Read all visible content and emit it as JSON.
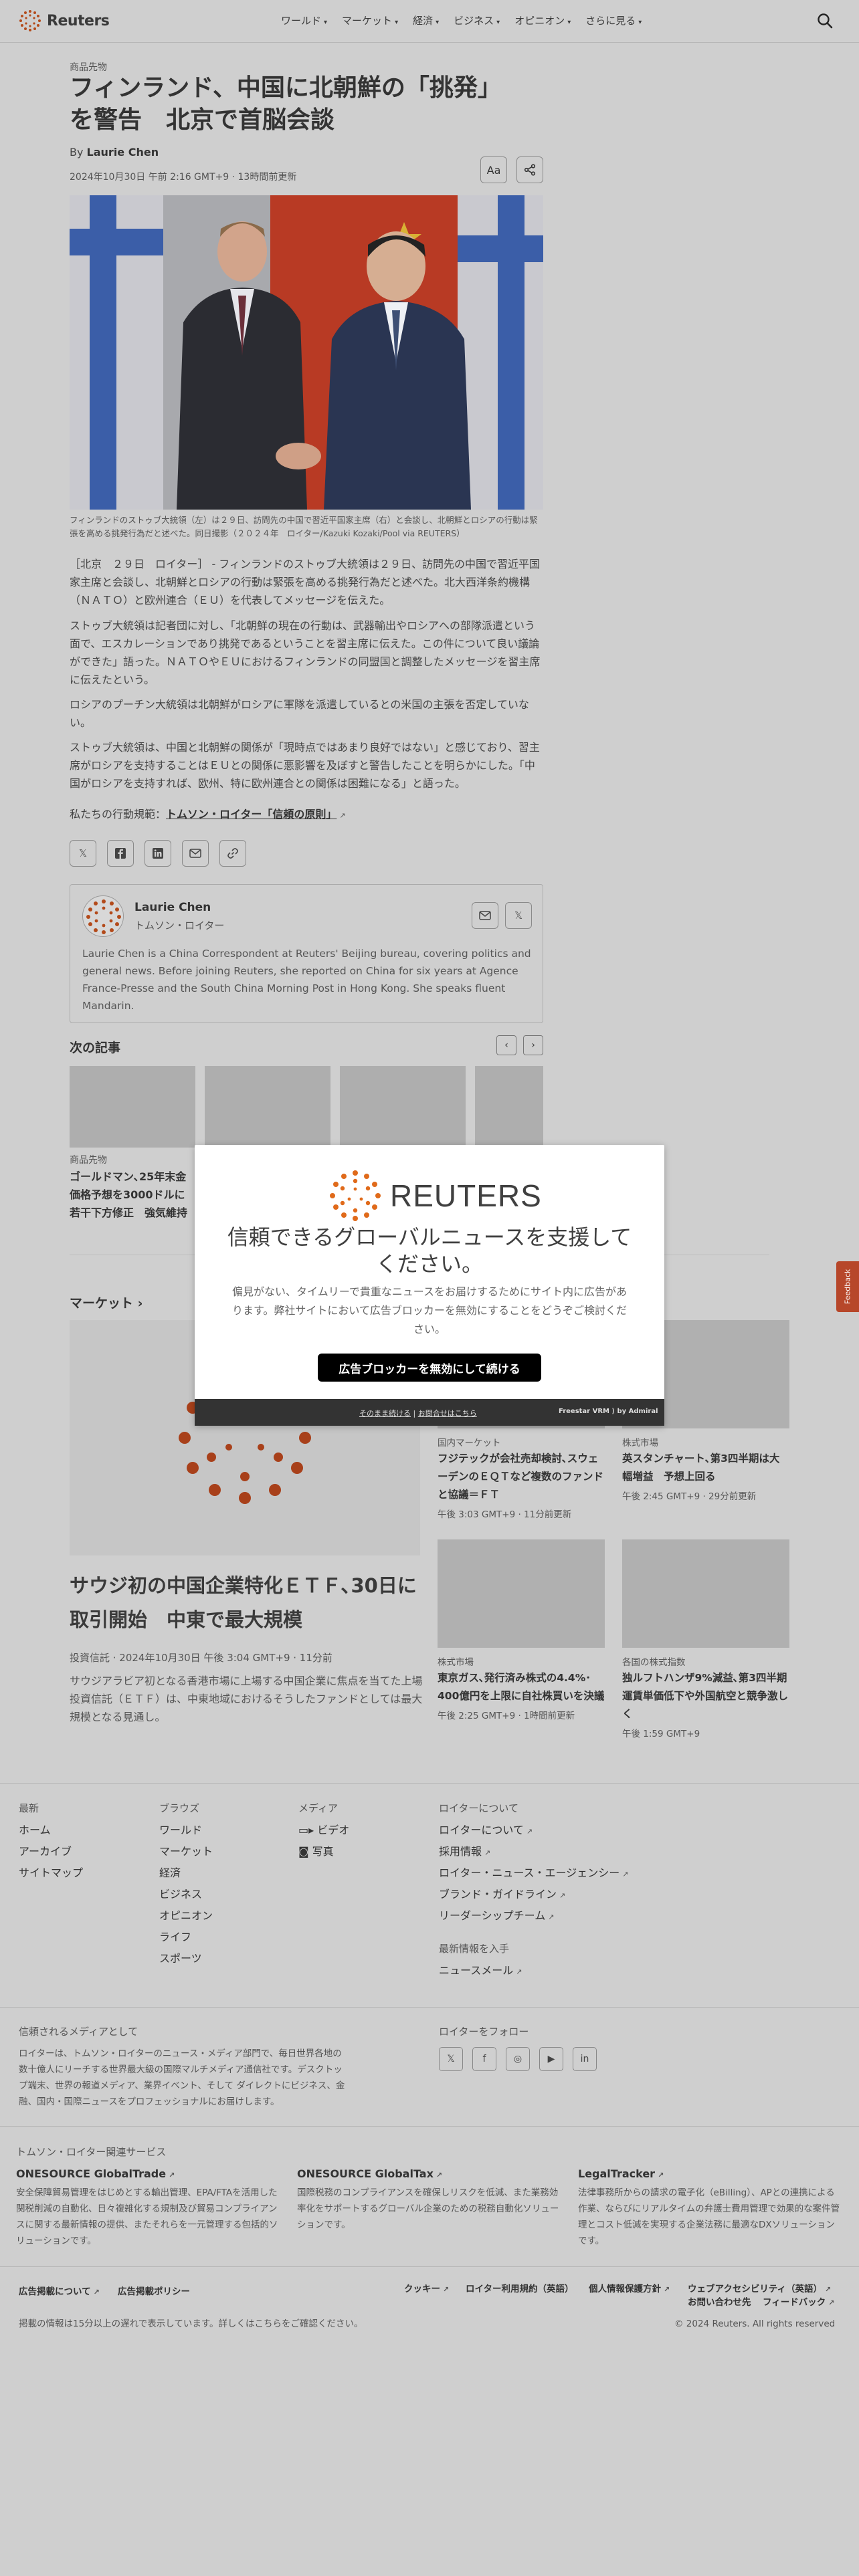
{
  "header": {
    "brand": "Reuters",
    "nav": [
      "ワールド",
      "マーケット",
      "経済",
      "ビジネス",
      "オピニオン",
      "さらに見る"
    ]
  },
  "article": {
    "kicker": "商品先物",
    "headline_line1": "フィンランド、中国に北朝鮮の「挑発」",
    "headline_line2": "を警告　北京で首脳会談",
    "byline_prefix": "By",
    "author": "Laurie Chen",
    "dateline": "2024年10月30日 午前 2:16 GMT+9 · 13時間前更新",
    "font_button": "Aa",
    "caption": "フィンランドのストゥブ大統領（左）は２９日、訪問先の中国で習近平国家主席（右）と会談し、北朝鮮とロシアの行動は緊張を高める挑発行為だと述べた。同日撮影（２０２４年　ロイター/Kazuki Kozaki/Pool via REUTERS）",
    "paragraphs": [
      "［北京　２９日　ロイター］ - フィンランドのストゥブ大統領は２９日、訪問先の中国で習近平国家主席と会談し、北朝鮮とロシアの行動は緊張を高める挑発行為だと述べた。北大西洋条約機構（ＮＡＴＯ）と欧州連合（ＥＵ）を代表してメッセージを伝えた。",
      "ストゥブ大統領は記者団に対し、「北朝鮮の現在の行動は、武器輸出やロシアへの部隊派遣という面で、エスカレーションであり挑発であるということを習主席に伝えた。この件について良い議論ができた」語った。ＮＡＴＯやＥＵにおけるフィンランドの同盟国と調整したメッセージを習主席に伝えたという。",
      "ロシアのプーチン大統領は北朝鮮がロシアに軍隊を派遣しているとの米国の主張を否定していない。",
      "ストゥブ大統領は、中国と北朝鮮の関係が「現時点ではあまり良好ではない」と感じており、習主席がロシアを支持することはＥＵとの関係に悪影響を及ぼすと警告したことを明らかにした。「中国がロシアを支持すれば、欧州、特に欧州連合との関係は困難になる」と語った。"
    ],
    "standards_prefix": "私たちの行動規範：",
    "standards_link": "トムソン・ロイター「信頼の原則」"
  },
  "author_box": {
    "name": "Laurie Chen",
    "org": "トムソン・ロイター",
    "bio": "Laurie Chen is a China Correspondent at Reuters' Beijing bureau, covering politics and general news. Before joining Reuters, she reported on China for six years at Agence France-Presse and the South China Morning Post in Hong Kong. She speaks fluent Mandarin."
  },
  "next": {
    "title": "次の記事",
    "cards": [
      {
        "category": "商品先物",
        "title": "ゴールドマン､25年末金価格予想を3000ドルに若干下方修正　強気維持"
      }
    ]
  },
  "markets": {
    "title": "マーケット",
    "main": {
      "title": "サウジ初の中国企業特化ＥＴＦ､30日に取引開始　中東で最大規模",
      "meta": "投資信託 · 2024年10月30日 午後 3:04 GMT+9 · 11分前",
      "desc": "サウジアラビア初となる香港市場に上場する中国企業に焦点を当てた上場投資信託（ＥＴＦ）は、中東地域におけるそうしたファンドとしては最大規模となる見通し。"
    },
    "cards": [
      {
        "category": "国内マーケット",
        "title": "フジテックが会社売却検討､スウェーデンのＥＱＴなど複数のファンドと協議＝ＦＴ",
        "time": "午後 3:03 GMT+9 · 11分前更新"
      },
      {
        "category": "株式市場",
        "title": "英スタンチャート､第3四半期は大幅増益　予想上回る",
        "time": "午後 2:45 GMT+9 · 29分前更新"
      },
      {
        "category": "株式市場",
        "title": "東京ガス､発行済み株式の4.4%･400億円を上限に自社株買いを決議",
        "time": "午後 2:25 GMT+9 · 1時間前更新"
      },
      {
        "category": "各国の株式指数",
        "title": "独ルフトハンザ9%減益､第3四半期　運賃単価低下や外国航空と競争激しく",
        "time": "午後 1:59 GMT+9"
      }
    ]
  },
  "footer": {
    "latest_head": "最新",
    "latest": [
      "ホーム",
      "アーカイブ",
      "サイトマップ"
    ],
    "browse_head": "ブラウズ",
    "browse": [
      "ワールド",
      "マーケット",
      "経済",
      "ビジネス",
      "オピニオン",
      "ライフ",
      "スポーツ"
    ],
    "media_head": "メディア",
    "media": [
      "ビデオ",
      "写真"
    ],
    "about_head": "ロイターについて",
    "about": [
      "ロイターについて",
      "採用情報",
      "ロイター・ニュース・エージェンシー",
      "ブランド・ガイドライン",
      "リーダーシップチーム"
    ],
    "latest_info_head": "最新情報を入手",
    "newsletter": "ニュースメール",
    "trusted_head": "信頼されるメディアとして",
    "trusted_text": "ロイターは、トムソン・ロイターのニュース・メディア部門で、毎日世界各地の数十億人にリーチする世界最大級の国際マルチメディア通信社です。デスクトップ端末、世界の報道メディア、業界イベント、そして ダイレクトにビジネス、金融、国内・国際ニュースをプロフェッショナルにお届けします。",
    "follow_head": "ロイターをフォロー",
    "services_head": "トムソン・ロイター関連サービス",
    "services": [
      {
        "title": "ONESOURCE GlobalTrade",
        "text": "安全保障貿易管理をはじめとする輸出管理、EPA/FTAを活用した関税削減の自動化、日々複雑化する規制及び貿易コンプライアンスに関する最新情報の提供、またそれらを一元管理する包括的ソリューションです。"
      },
      {
        "title": "ONESOURCE GlobalTax",
        "text": "国際税務のコンプライアンスを確保しリスクを低減、また業務効率化をサポートするグローバル企業のための税務自動化ソリューションです。"
      },
      {
        "title": "LegalTracker",
        "text": "法律事務所からの請求の電子化（eBilling）、APとの連携による作業、ならびにリアルタイムの弁護士費用管理で効果的な案件管理とコスト低減を実現する企業法務に最適なDXソリューションです。"
      }
    ],
    "legal_left": [
      "広告掲載について",
      "広告掲載ポリシー"
    ],
    "legal_right": [
      "クッキー",
      "ロイター利用規約（英語）",
      "個人情報保護方針",
      "ウェブアクセシビリティ（英語）"
    ],
    "legal_right2": [
      "お問い合わせ先",
      "フィードバック"
    ],
    "disclaimer": "掲載の情報は15分以上の遅れで表示しています。詳しくはこちらをご確認ください。",
    "copyright": "© 2024 Reuters. All rights reserved"
  },
  "modal": {
    "brand": "REUTERS",
    "title": "信頼できるグローバルニュースを支援してください。",
    "text": "偏見がない、タイムリーで貴重なニュースをお届けするためにサイト内に広告があります。弊社サイトにおいて広告ブロッカーを無効にすることをどうぞご検討ください。",
    "button": "広告ブロッカーを無効にして続ける",
    "foot_link1": "そのまま続ける",
    "foot_sep": "|",
    "foot_link2": "お問合せはこちら",
    "foot_brand": "Freestar VRM ⟩ by Admiral"
  },
  "feedback": "Feedback"
}
